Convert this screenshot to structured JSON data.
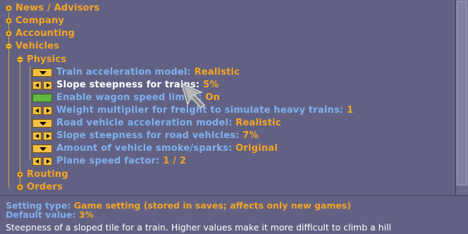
{
  "tree": {
    "categories": [
      {
        "label": "News / Advisors",
        "state": "collapsed"
      },
      {
        "label": "Company",
        "state": "collapsed"
      },
      {
        "label": "Accounting",
        "state": "collapsed"
      },
      {
        "label": "Vehicles",
        "state": "expanded"
      }
    ],
    "physics": {
      "label": "Physics",
      "state": "expanded"
    },
    "settings": [
      {
        "label": "Train acceleration model: ",
        "value": "Realistic",
        "control": "dropdown"
      },
      {
        "label": "Slope steepness for trains: ",
        "value": "5%",
        "control": "arrows",
        "selected": true
      },
      {
        "label": "Enable wagon speed limits: ",
        "value": "On",
        "control": "toggle"
      },
      {
        "label": "Weight multiplier for freight to simulate heavy trains: ",
        "value": "1",
        "control": "arrows"
      },
      {
        "label": "Road vehicle acceleration model: ",
        "value": "Realistic",
        "control": "dropdown"
      },
      {
        "label": "Slope steepness for road vehicles: ",
        "value": "7%",
        "control": "arrows"
      },
      {
        "label": "Amount of vehicle smoke/sparks: ",
        "value": "Original",
        "control": "dropdown"
      },
      {
        "label": "Plane speed factor: ",
        "value": "1 / 2",
        "control": "arrows"
      }
    ],
    "subcategories": [
      {
        "label": "Routing",
        "state": "collapsed"
      },
      {
        "label": "Orders",
        "state": "collapsed"
      }
    ]
  },
  "info": {
    "type_key": "Setting type: ",
    "type_val": "Game setting (stored in saves; affects only new games)",
    "default_key": "Default value: ",
    "default_val": "3%",
    "description": "Steepness of a sloped tile for a train. Higher values make it more difficult to climb a hill"
  },
  "colors": {
    "background": "#626183",
    "category_text": "#f5a524",
    "setting_text": "#7fb1ef",
    "selected_text": "#ffffff",
    "value_text": "#f5a524",
    "toggle_on": "#64b53f"
  }
}
